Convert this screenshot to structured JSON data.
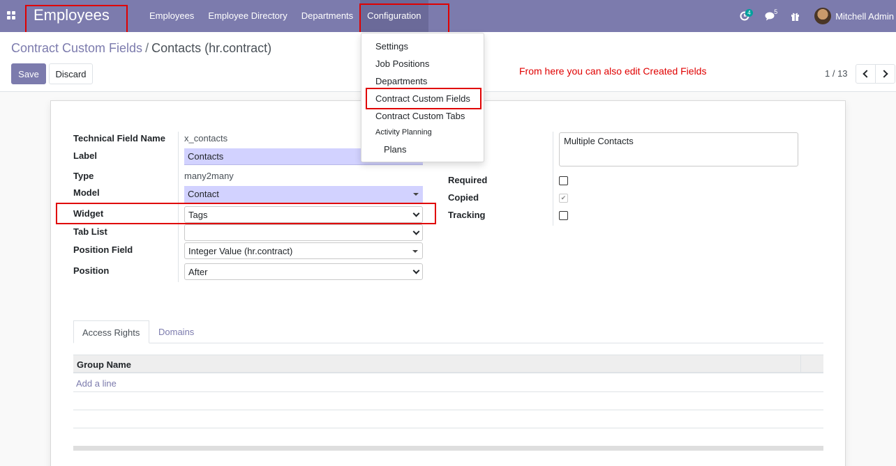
{
  "navbar": {
    "app_title": "Employees",
    "menu": [
      "Employees",
      "Employee Directory",
      "Departments",
      "Configuration"
    ],
    "activity_badge": "4",
    "messages_badge": "5",
    "user_name": "Mitchell Admin"
  },
  "breadcrumb": {
    "parent": "Contract Custom Fields",
    "separator": "/",
    "current": "Contacts (hr.contract)"
  },
  "actions": {
    "save_label": "Save",
    "discard_label": "Discard"
  },
  "annotation_text": "From here you can also edit Created Fields",
  "pager": {
    "value": "1 / 13"
  },
  "configuration_menu": {
    "items": [
      "Settings",
      "Job Positions",
      "Departments",
      "Contract Custom Fields",
      "Contract Custom Tabs"
    ],
    "section_header": "Activity Planning",
    "sub_items": [
      "Plans"
    ]
  },
  "form": {
    "technical_field_name": {
      "label": "Technical Field Name",
      "value": "x_contacts"
    },
    "label_field": {
      "label": "Label",
      "value": "Contacts"
    },
    "type": {
      "label": "Type",
      "value": "many2many"
    },
    "model": {
      "label": "Model",
      "value": "Contact"
    },
    "widget": {
      "label": "Widget",
      "value": "Tags"
    },
    "tab_list": {
      "label": "Tab List",
      "value": ""
    },
    "position_field": {
      "label": "Position Field",
      "value": "Integer Value (hr.contract)"
    },
    "position": {
      "label": "Position",
      "value": "After"
    },
    "description_value": "Multiple Contacts",
    "required": {
      "label": "Required",
      "checked": false
    },
    "copied": {
      "label": "Copied",
      "checked": true
    },
    "tracking": {
      "label": "Tracking",
      "checked": false
    }
  },
  "notebook": {
    "tabs": [
      "Access Rights",
      "Domains"
    ],
    "active_tab": "Access Rights",
    "table_header": "Group Name",
    "add_line": "Add a line"
  },
  "colors": {
    "brand": "#7c7bad",
    "annotation_red": "#e00000",
    "required_field_bg": "#d2d2ff"
  }
}
